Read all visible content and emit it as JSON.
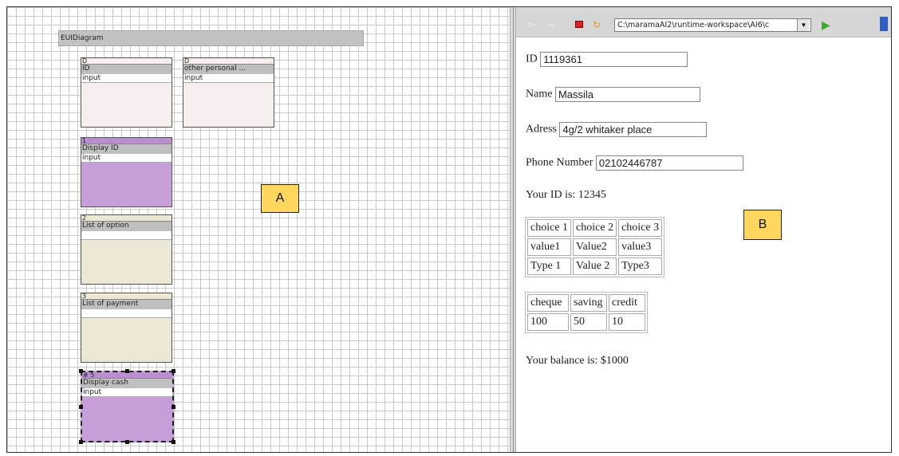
{
  "diagram": {
    "title": "EUIDiagram",
    "elements": [
      {
        "id": "D",
        "name": "ID",
        "type": "input"
      },
      {
        "id": "D",
        "name": "other personal ...",
        "type": "input"
      },
      {
        "id": "1",
        "name": "Display ID",
        "type": "input"
      },
      {
        "id": "2",
        "name": "List of option",
        "type": ""
      },
      {
        "id": "3",
        "name": "List of payment",
        "type": ""
      },
      {
        "id": "# 5",
        "name": "Display cash",
        "type": "input"
      }
    ],
    "marker": "A"
  },
  "browser": {
    "address": "C:\\maramaAI2\\runtime-workspace\\AI6\\c",
    "marker": "B",
    "form": {
      "id_label": "ID",
      "id_value": "1119361",
      "name_label": "Name",
      "name_value": "Massila",
      "address_label": "Adress",
      "address_value": "4g/2 whitaker place",
      "phone_label": "Phone Number",
      "phone_value": "02102446787"
    },
    "your_id": "Your ID is: 12345",
    "choices_table": [
      [
        "choice 1",
        "choice 2",
        "choice 3"
      ],
      [
        "value1",
        "Value2",
        "value3"
      ],
      [
        "Type 1",
        "Value 2",
        "Type3"
      ]
    ],
    "payment_table": {
      "headers": [
        "cheque",
        "saving",
        "credit"
      ],
      "values": [
        "100",
        "50",
        "10"
      ]
    },
    "balance": "Your balance is: $1000"
  },
  "icons": [
    "back-arrow-icon",
    "forward-arrow-icon",
    "stop-icon",
    "refresh-icon",
    "dropdown-arrow-icon",
    "go-icon"
  ],
  "colors": {
    "marker": "#ffd75e",
    "display_element": "#c79fd8",
    "list_element": "#ece7d4",
    "input_element": "#f7eeee"
  }
}
